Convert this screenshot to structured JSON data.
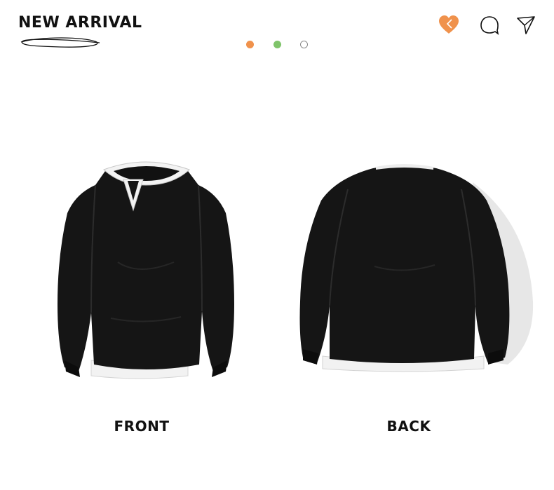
{
  "header": {
    "title": "NEW ARRIVAL"
  },
  "carousel": {
    "dots": [
      {
        "color": "#f0924c",
        "state": "filled"
      },
      {
        "color": "#7fc46a",
        "state": "filled"
      },
      {
        "color": "#8a8a8a",
        "state": "outline"
      }
    ]
  },
  "actions": {
    "like_icon": "heart-icon",
    "like_color": "#f0924c",
    "comment_icon": "comment-icon",
    "share_icon": "send-icon"
  },
  "products": [
    {
      "caption": "FRONT",
      "view": "front"
    },
    {
      "caption": "BACK",
      "view": "back"
    }
  ]
}
